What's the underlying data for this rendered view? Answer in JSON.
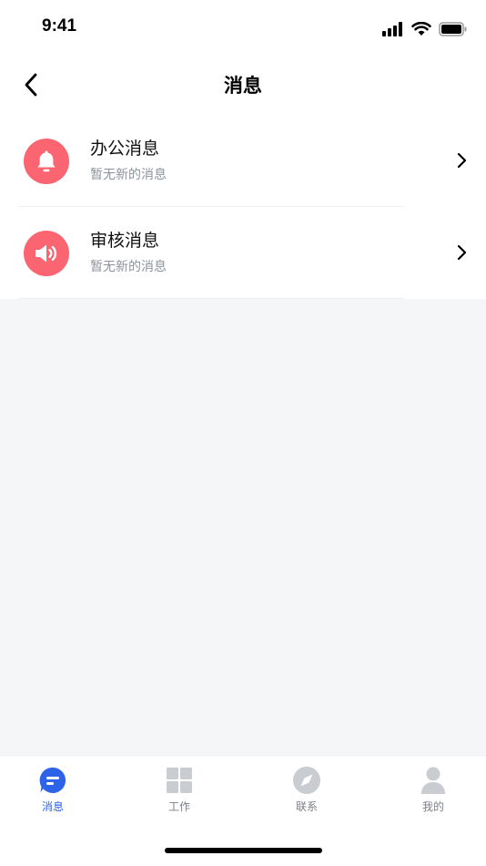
{
  "status_bar": {
    "time": "9:41"
  },
  "nav": {
    "title": "消息"
  },
  "messages": [
    {
      "title": "办公消息",
      "subtitle": "暂无新的消息",
      "icon": "bell-icon"
    },
    {
      "title": "审核消息",
      "subtitle": "暂无新的消息",
      "icon": "speaker-icon"
    }
  ],
  "tabs": [
    {
      "label": "消息",
      "icon": "message-icon",
      "active": true
    },
    {
      "label": "工作",
      "icon": "grid-icon",
      "active": false
    },
    {
      "label": "联系",
      "icon": "compass-icon",
      "active": false
    },
    {
      "label": "我的",
      "icon": "user-icon",
      "active": false
    }
  ],
  "colors": {
    "accent": "#2d63e8",
    "icon_bg": "#fb6471",
    "inactive_icon": "#c9ccd1",
    "background": "#f5f6f8"
  }
}
